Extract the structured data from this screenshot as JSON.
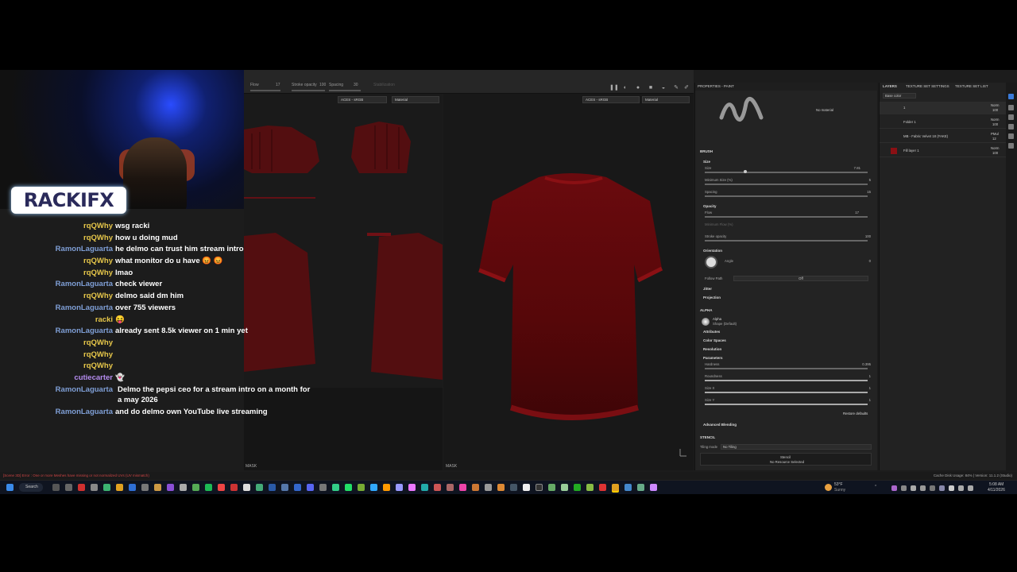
{
  "chat": [
    {
      "user": "",
      "text": "wsg racki",
      "color": "#e8c84a"
    },
    {
      "user": "rqQWhy",
      "text": "how u doing mud",
      "color": "#e8c84a"
    },
    {
      "user": "RamonLaguarta",
      "text": "he delmo can trust him stream intro",
      "color": "#7f9fd6"
    },
    {
      "user": "rqQWhy",
      "text": "what monitor do u have 😡 😡",
      "color": "#e8c84a"
    },
    {
      "user": "rqQWhy",
      "text": "lmao",
      "color": "#e8c84a"
    },
    {
      "user": "RamonLaguarta",
      "text": "check viewer",
      "color": "#7f9fd6"
    },
    {
      "user": "rqQWhy",
      "text": "delmo said dm him",
      "color": "#e8c84a"
    },
    {
      "user": "RamonLaguarta",
      "text": "over 755 viewers",
      "color": "#7f9fd6"
    },
    {
      "user": "racki",
      "text": "😝",
      "color": "#e8c84a"
    },
    {
      "user": "RamonLaguarta",
      "text": "already sent 8.5k viewer on 1 min yet",
      "color": "#7f9fd6"
    },
    {
      "user": "rqQWhy",
      "text": "",
      "color": "#e8c84a"
    },
    {
      "user": "rqQWhy",
      "text": "",
      "color": "#e8c84a"
    },
    {
      "user": "rqQWhy",
      "text": "",
      "color": "#e8c84a"
    },
    {
      "user": "cutiecarter",
      "text": "👻",
      "color": "#b58cf0"
    },
    {
      "user": "RamonLaguarta",
      "text": "Delmo the pepsi ceo for a stream intro on a month for a may 2026",
      "color": "#7f9fd6",
      "multi": true
    },
    {
      "user": "RamonLaguarta",
      "text": "and do delmo own YouTube live streaming",
      "color": "#7f9fd6"
    }
  ],
  "chat_first_user": "rqQWhy",
  "logo": "RACKIFX",
  "toolbar": {
    "flow": "Flow",
    "flow_val": "17",
    "stroke_opacity": "Stroke opacity",
    "stroke_val": "100",
    "spacing": "Spacing",
    "spacing_val": "30",
    "stabilization": "Stabilization"
  },
  "viewports": {
    "uv_colorspace": "ACES - sRGB",
    "uv_channel": "Material",
    "mesh_colorspace": "ACES - sRGB",
    "mesh_channel": "Material",
    "mask_label": "MASK"
  },
  "properties": {
    "title": "PROPERTIES - PAINT",
    "no_material": "No material",
    "brush": "BRUSH",
    "size": "Size",
    "size_value": "7.81",
    "size_sub": "Size",
    "min_size": "Minimum Size (%)",
    "min_size_value": "5",
    "spacing": "Spacing",
    "spacing_value": "15",
    "opacity": "Opacity",
    "flow": "Flow",
    "flow_value": "17",
    "min_flow": "Minimum Flow (%)",
    "stroke_opacity": "Stroke opacity",
    "stroke_opacity_value": "100",
    "orientation": "Orientation",
    "angle": "Angle",
    "angle_value": "0",
    "follow_path": "Follow Path",
    "follow_path_value": "Off",
    "jitter": "Jitter",
    "projection": "Projection",
    "alpha": "ALPHA",
    "alpha_name": "Alpha",
    "alpha_shape": "Shape (Default)",
    "attributes": "Attributes",
    "color_spaces": "Color Spaces",
    "resolution": "Resolution",
    "parameters": "Parameters",
    "hardness": "Hardness",
    "hardness_value": "0.395",
    "roundness": "Roundness",
    "roundness_value": "1",
    "size_x": "Size X",
    "size_x_value": "1",
    "size_y": "Size Y",
    "size_y_value": "1",
    "restore": "Restore defaults",
    "advanced": "Advanced Blending",
    "stencil": "STENCIL",
    "tiling": "Tiling mode",
    "tiling_value": "No Tiling",
    "stencil_value": "Stencil",
    "no_resource": "No Resource Selected"
  },
  "layers": {
    "tab1": "LAYERS",
    "tab2": "TEXTURE SET SETTINGS",
    "tab3": "TEXTURE SET LIST",
    "channel": "Base color",
    "rows": [
      {
        "name": "1",
        "blend": "Norm",
        "opacity": "100"
      },
      {
        "name": "Folder 1",
        "blend": "Norm",
        "opacity": "100"
      },
      {
        "name": "MB - Fabric Velvet 18 (FAKE)",
        "blend": "PMul",
        "opacity": "12"
      },
      {
        "name": "Fill layer 1",
        "blend": "Norm",
        "opacity": "100"
      }
    ]
  },
  "status": {
    "left": "[Scene 3D] Error : One or more Meshes have missing or not normalized UVs (UV mismatch)",
    "right": "Cache Disk Usage: 84% | Version: 11.1.2 (Studio)"
  },
  "taskbar": {
    "search": "Search",
    "weather": "53°F",
    "weather_desc": "Sunny",
    "time": "5:08 AM",
    "date": "4/11/2026"
  }
}
